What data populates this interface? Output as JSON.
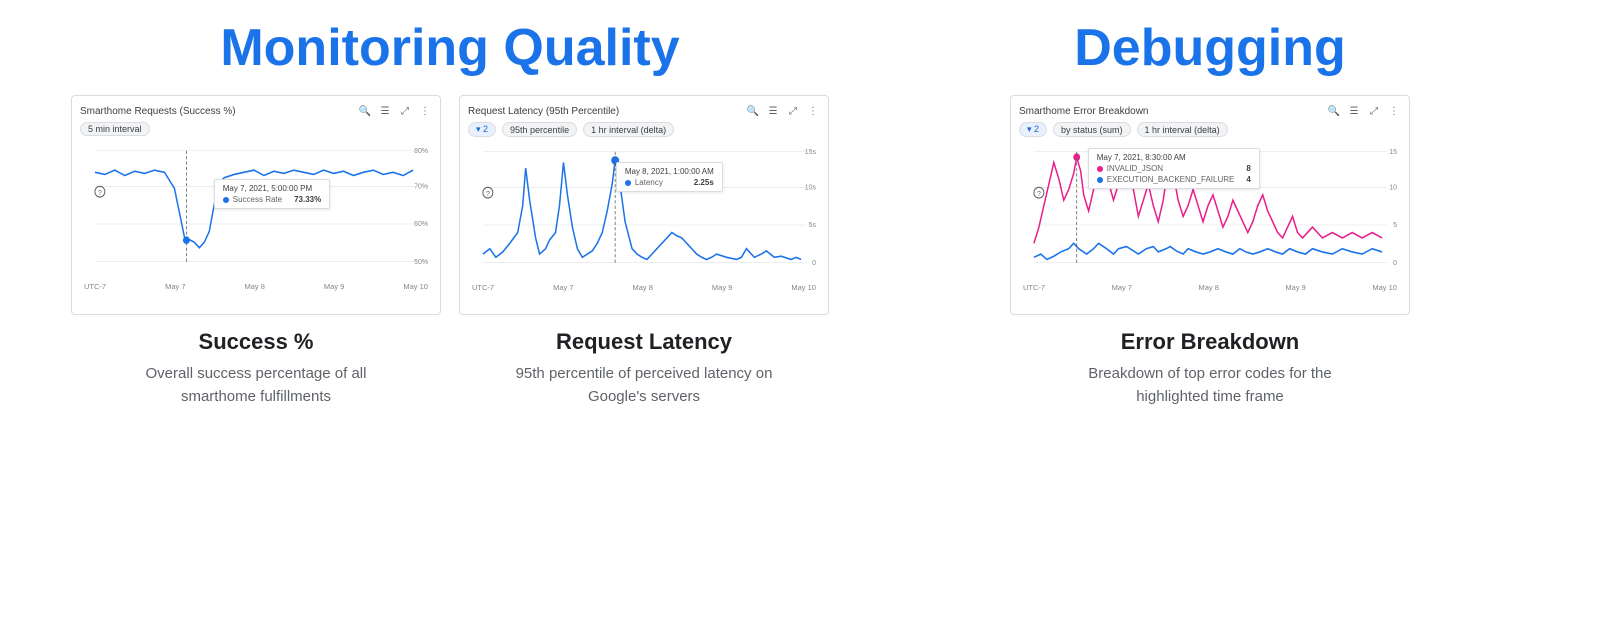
{
  "monitoring": {
    "title": "Monitoring Quality",
    "charts": [
      {
        "id": "success-chart",
        "title": "Smarthome Requests (Success %)",
        "tags": [
          "5 min interval"
        ],
        "filter_count": null,
        "tooltip": {
          "date": "May 7, 2021, 5:00:00 PM",
          "metric": "Success Rate",
          "value": "73.33%",
          "color": "#1a73e8"
        },
        "x_labels": [
          "UTC-7",
          "May 7",
          "May 8",
          "May 9",
          "May 10"
        ],
        "y_labels": [
          "80%",
          "70%",
          "60%",
          "50%"
        ]
      },
      {
        "id": "latency-chart",
        "title": "Request Latency (95th Percentile)",
        "tags": [
          "95th percentile",
          "1 hr interval (delta)"
        ],
        "filter_count": "2",
        "tooltip": {
          "date": "May 8, 2021, 1:00:00 AM",
          "metric": "Latency",
          "value": "2.25s",
          "color": "#1a73e8"
        },
        "x_labels": [
          "UTC-7",
          "May 7",
          "May 8",
          "May 9",
          "May 10"
        ],
        "y_labels": [
          "15s",
          "10s",
          "5s",
          "0"
        ]
      }
    ],
    "metrics": [
      {
        "title": "Success %",
        "description": "Overall success percentage of all smarthome fulfillments"
      },
      {
        "title": "Request Latency",
        "description": "95th percentile of perceived latency on Google's servers"
      }
    ]
  },
  "debugging": {
    "title": "Debugging",
    "chart": {
      "id": "error-chart",
      "title": "Smarthome Error Breakdown",
      "tags": [
        "by status (sum)",
        "1 hr interval (delta)"
      ],
      "filter_count": "2",
      "tooltip": {
        "date": "May 7, 2021, 8:30:00 AM",
        "entries": [
          {
            "metric": "INVALID_JSON",
            "value": "8",
            "color": "#e91e8c"
          },
          {
            "metric": "EXECUTION_BACKEND_FAILURE",
            "value": "4",
            "color": "#1a73e8"
          }
        ]
      },
      "x_labels": [
        "UTC-7",
        "May 7",
        "May 8",
        "May 9",
        "May 10"
      ],
      "y_labels": [
        "15",
        "10",
        "5",
        "0"
      ]
    },
    "metric": {
      "title": "Error Breakdown",
      "description": "Breakdown of top error codes for the highlighted time frame"
    }
  },
  "icons": {
    "search": "🔍",
    "legend": "≡",
    "expand": "⤢",
    "more": "⋮",
    "filter": "▾"
  }
}
